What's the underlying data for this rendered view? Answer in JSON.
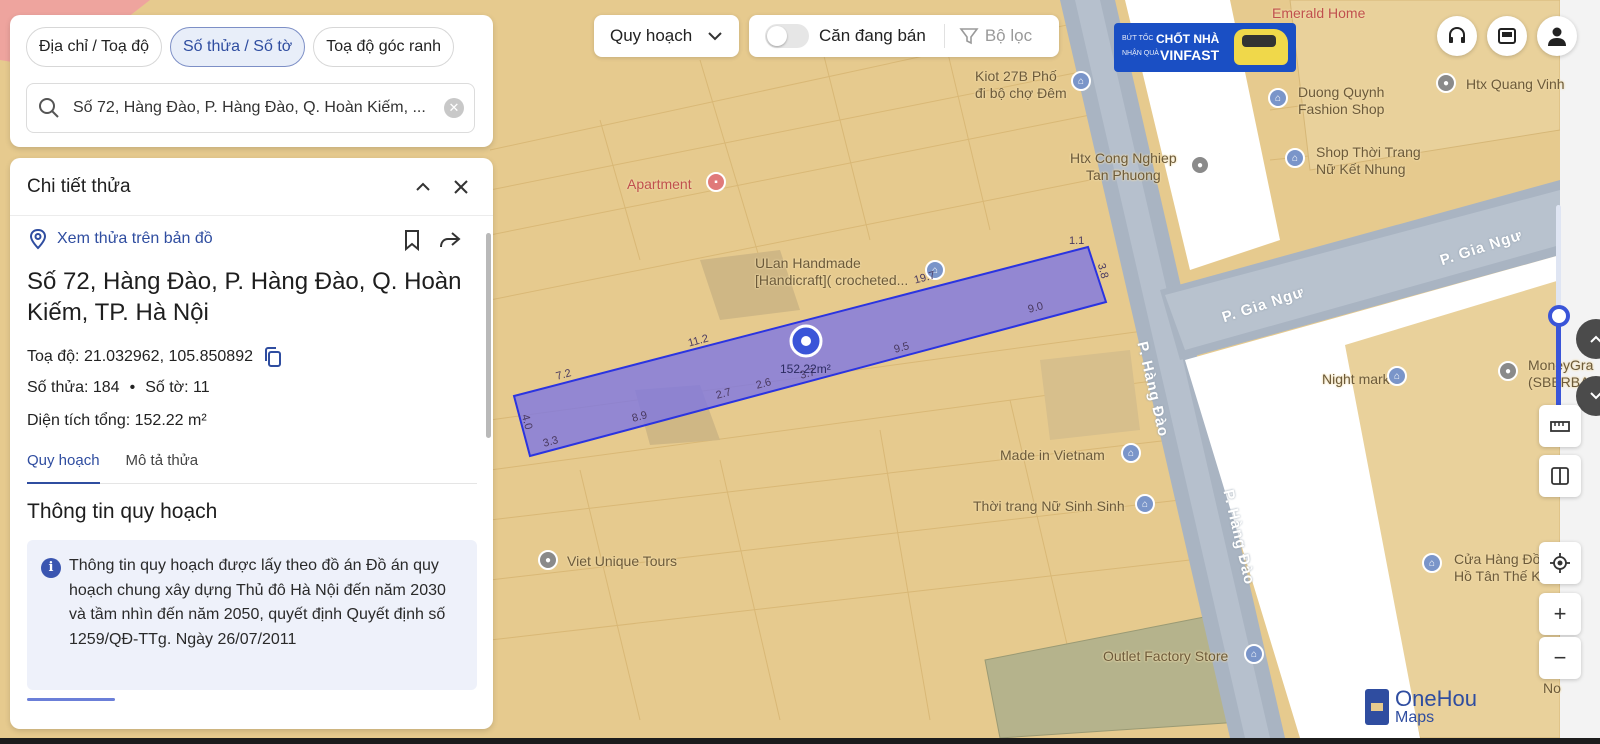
{
  "search": {
    "tabs": [
      "Địa chỉ / Toạ độ",
      "Số thửa / Số tờ",
      "Toạ độ góc ranh"
    ],
    "active_tab": 1,
    "query": "Số 72, Hàng Đào, P. Hàng Đào, Q. Hoàn Kiếm, ..."
  },
  "detail": {
    "title": "Chi tiết thửa",
    "view_on_map": "Xem thửa trên bản đồ",
    "address": "Số 72, Hàng Đào, P. Hàng Đào, Q. Hoàn Kiếm, TP. Hà Nội",
    "coords_label": "Toạ độ:",
    "coords_value": "21.032962, 105.850892",
    "parcel_label": "Số thửa:",
    "parcel_value": "184",
    "sheet_label": "Số tờ:",
    "sheet_value": "11",
    "area_label": "Diện tích tổng:",
    "area_value": "152.22 m²",
    "tabs": [
      "Quy hoạch",
      "Mô tả thửa"
    ],
    "section_title": "Thông tin quy hoạch",
    "note": "Thông tin quy hoạch được lấy theo đồ án Đồ án quy hoạch chung xây dựng Thủ đô Hà Nội đến năm 2030 và tầm nhìn đến năm 2050, quyết định Quyết định số 1259/QĐ-TTg. Ngày 26/07/2011"
  },
  "toolbar": {
    "planning_label": "Quy hoạch",
    "for_sale_label": "Căn đang bán",
    "filter_label": "Bộ lọc"
  },
  "ad": {
    "small1": "BỨT TỐC",
    "big1": "CHỐT NHÀ",
    "small2": "NHẬN QUÀ",
    "big2": "VINFAST"
  },
  "map": {
    "parcel_area": "152.22m²",
    "edges": [
      "1.1",
      "3.8",
      "19.7",
      "9.0",
      "11.2",
      "9.5",
      "7.2",
      "2.7",
      "2.6",
      "3.7",
      "8.9",
      "4.0",
      "3.3"
    ],
    "streets": [
      "P. Hàng Đào",
      "P. Hàng Đào",
      "P. Gia Ngư",
      "P. Gia Ngư"
    ],
    "places": {
      "kiot": "Kiot 27B Phố\nđi bộ chợ Đêm",
      "apartment": "Apartment",
      "htx": "Htx Cong Nghiep\nTan Phuong",
      "ulan": "ULan Handmade\n[Handicraft]( crocheted...",
      "duong": "Duong Quynh\nFashion Shop",
      "shop": "Shop Thời Trang\nNữ Kết Nhung",
      "htxqv": "Htx Quang Vinh",
      "emerald": "Emerald Home",
      "night": "Night market",
      "money": "MoneyGra\n(SBERBAN",
      "made": "Made in Vietnam",
      "thoitrang": "Thời trang Nữ Sinh Sinh",
      "viet": "Viet Unique Tours",
      "cuahang": "Cửa Hàng Đồ\nHồ Tân Thế K",
      "outlet": "Outlet Factory Store",
      "xix": "Xix\nNo"
    }
  },
  "logo": {
    "line1": "OneHou",
    "line2": "Maps"
  },
  "colors": {
    "accent": "#2f4da0",
    "parcel": "#7b74e6",
    "map_bg": "#e6ca8e",
    "road": "#a9b4c2"
  }
}
